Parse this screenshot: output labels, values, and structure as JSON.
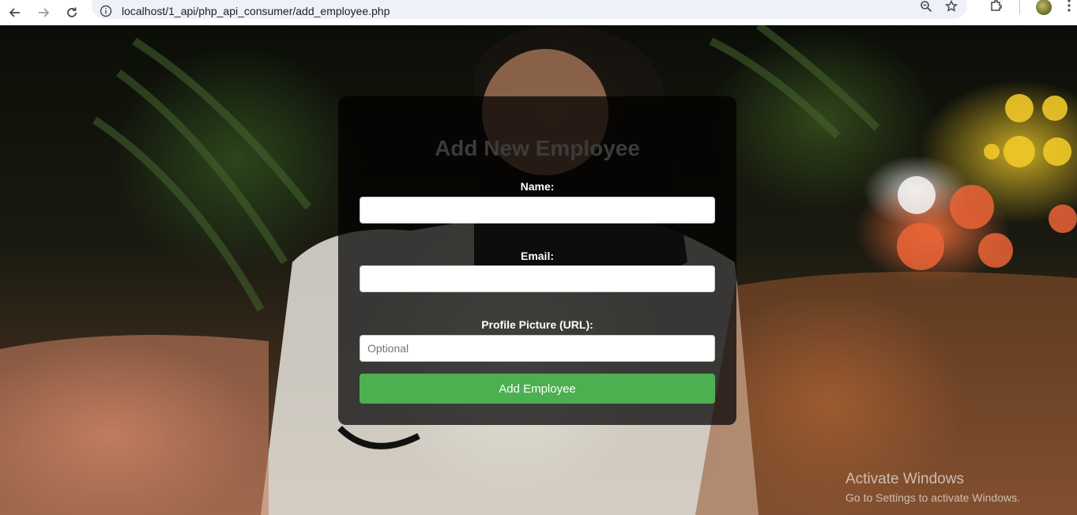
{
  "browser": {
    "url": "localhost/1_api/php_api_consumer/add_employee.php",
    "icons": [
      "back-arrow-icon",
      "forward-arrow-icon",
      "reload-icon",
      "site-info-icon",
      "zoom-icon",
      "bookmark-star-icon",
      "extensions-icon",
      "profile-avatar",
      "menu-kebab-icon"
    ]
  },
  "form": {
    "title": "Add New Employee",
    "fields": [
      {
        "label": "Name:",
        "value": "",
        "placeholder": ""
      },
      {
        "label": "Email:",
        "value": "",
        "placeholder": ""
      },
      {
        "label": "Profile Picture (URL):",
        "value": "",
        "placeholder": "Optional"
      }
    ],
    "submit_label": "Add Employee"
  },
  "watermark": {
    "title": "Activate Windows",
    "subtitle": "Go to Settings to activate Windows."
  },
  "colors": {
    "submit_button": "#4caf50",
    "card_background": "rgba(0,0,0,0.72)",
    "title_color": "#3b3b3b"
  }
}
